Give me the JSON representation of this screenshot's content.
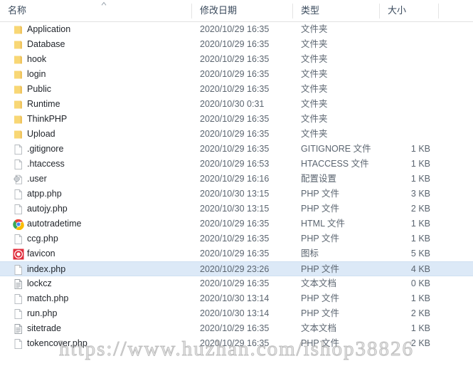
{
  "window": {
    "type": "file-explorer-list"
  },
  "header": {
    "columns": [
      {
        "key": "name",
        "label": "名称",
        "sorted": true,
        "sort_dir": "asc"
      },
      {
        "key": "date",
        "label": "修改日期",
        "sorted": false
      },
      {
        "key": "type",
        "label": "类型",
        "sorted": false
      },
      {
        "key": "size",
        "label": "大小",
        "sorted": false
      }
    ]
  },
  "rows": [
    {
      "name": "Application",
      "date": "2020/10/29 16:35",
      "type": "文件夹",
      "size": "",
      "icon": "folder-icon",
      "selected": false
    },
    {
      "name": "Database",
      "date": "2020/10/29 16:35",
      "type": "文件夹",
      "size": "",
      "icon": "folder-icon",
      "selected": false
    },
    {
      "name": "hook",
      "date": "2020/10/29 16:35",
      "type": "文件夹",
      "size": "",
      "icon": "folder-icon",
      "selected": false
    },
    {
      "name": "login",
      "date": "2020/10/29 16:35",
      "type": "文件夹",
      "size": "",
      "icon": "folder-icon",
      "selected": false
    },
    {
      "name": "Public",
      "date": "2020/10/29 16:35",
      "type": "文件夹",
      "size": "",
      "icon": "folder-icon",
      "selected": false
    },
    {
      "name": "Runtime",
      "date": "2020/10/30 0:31",
      "type": "文件夹",
      "size": "",
      "icon": "folder-icon",
      "selected": false
    },
    {
      "name": "ThinkPHP",
      "date": "2020/10/29 16:35",
      "type": "文件夹",
      "size": "",
      "icon": "folder-icon",
      "selected": false
    },
    {
      "name": "Upload",
      "date": "2020/10/29 16:35",
      "type": "文件夹",
      "size": "",
      "icon": "folder-icon",
      "selected": false
    },
    {
      "name": ".gitignore",
      "date": "2020/10/29 16:35",
      "type": "GITIGNORE 文件",
      "size": "1 KB",
      "icon": "blank-document-icon",
      "selected": false
    },
    {
      "name": ".htaccess",
      "date": "2020/10/29 16:53",
      "type": "HTACCESS 文件",
      "size": "1 KB",
      "icon": "blank-document-icon",
      "selected": false
    },
    {
      "name": ".user",
      "date": "2020/10/29 16:16",
      "type": "配置设置",
      "size": "1 KB",
      "icon": "config-settings-icon",
      "selected": false
    },
    {
      "name": "atpp.php",
      "date": "2020/10/30 13:15",
      "type": "PHP 文件",
      "size": "3 KB",
      "icon": "blank-document-icon",
      "selected": false
    },
    {
      "name": "autojy.php",
      "date": "2020/10/30 13:15",
      "type": "PHP 文件",
      "size": "2 KB",
      "icon": "blank-document-icon",
      "selected": false
    },
    {
      "name": "autotradetime",
      "date": "2020/10/29 16:35",
      "type": "HTML 文件",
      "size": "1 KB",
      "icon": "chrome-icon",
      "selected": false
    },
    {
      "name": "ccg.php",
      "date": "2020/10/29 16:35",
      "type": "PHP 文件",
      "size": "1 KB",
      "icon": "blank-document-icon",
      "selected": false
    },
    {
      "name": "favicon",
      "date": "2020/10/29 16:35",
      "type": "图标",
      "size": "5 KB",
      "icon": "favicon-icon",
      "selected": false
    },
    {
      "name": "index.php",
      "date": "2020/10/29 23:26",
      "type": "PHP 文件",
      "size": "4 KB",
      "icon": "blank-document-icon",
      "selected": true
    },
    {
      "name": "lockcz",
      "date": "2020/10/29 16:35",
      "type": "文本文档",
      "size": "0 KB",
      "icon": "text-document-icon",
      "selected": false
    },
    {
      "name": "match.php",
      "date": "2020/10/30 13:14",
      "type": "PHP 文件",
      "size": "1 KB",
      "icon": "blank-document-icon",
      "selected": false
    },
    {
      "name": "run.php",
      "date": "2020/10/30 13:14",
      "type": "PHP 文件",
      "size": "2 KB",
      "icon": "blank-document-icon",
      "selected": false
    },
    {
      "name": "sitetrade",
      "date": "2020/10/29 16:35",
      "type": "文本文档",
      "size": "1 KB",
      "icon": "text-document-icon",
      "selected": false
    },
    {
      "name": "tokencover.php",
      "date": "2020/10/29 16:35",
      "type": "PHP 文件",
      "size": "2 KB",
      "icon": "blank-document-icon",
      "selected": false
    }
  ],
  "watermark": {
    "text": "https://www.huzhan.com/ishop38826"
  },
  "colors": {
    "selection": "#dce9f7",
    "folder": "#f8d775",
    "header_text": "#3a4a5c",
    "row_text": "#1f2329",
    "secondary_text": "#5b6570",
    "divider": "#e4e4e4",
    "favicon_red": "#e02d3c",
    "chrome_green": "#3aa757",
    "chrome_red": "#ea4335",
    "chrome_yellow": "#fbbc05",
    "chrome_blue": "#4285f4"
  }
}
